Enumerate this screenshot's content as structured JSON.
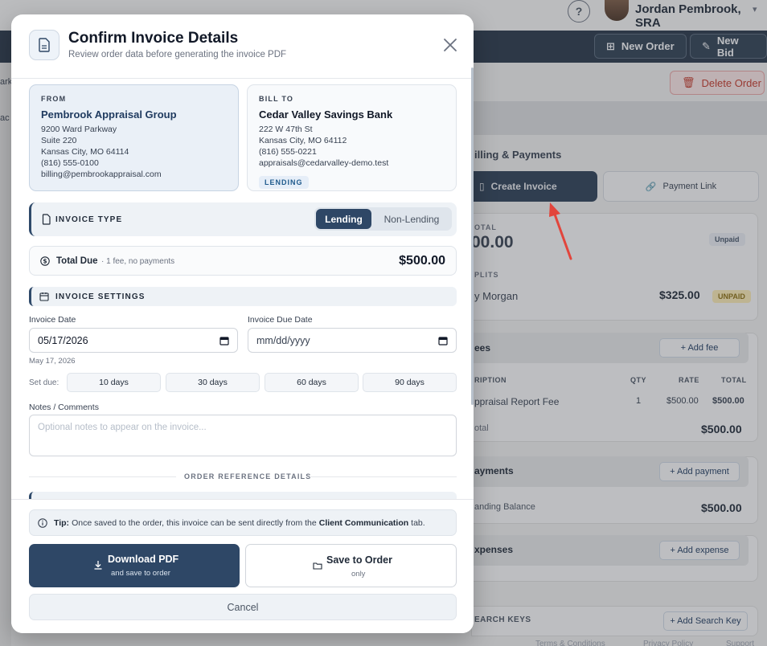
{
  "background": {
    "user_name": "Jordan Pembrook, SRA",
    "nav": {
      "new_order": "New Order",
      "new_bid": "New Bid"
    },
    "delete_order": "Delete Order",
    "billing_title": "illing & Payments",
    "create_invoice": "Create Invoice",
    "payment_link": "Payment Link",
    "total_label": "OTAL",
    "total_value": "00.00",
    "total_status": "Unpaid",
    "splits_label": "PLITS",
    "split_name": "y Morgan",
    "split_amount": "$325.00",
    "split_status": "UNPAID",
    "fees_title": "ees",
    "add_fee": "+ Add fee",
    "table_headers": {
      "desc": "RIPTION",
      "qty": "QTY",
      "rate": "RATE",
      "total": "TOTAL"
    },
    "fee_row": {
      "desc": "ppraisal Report Fee",
      "qty": "1",
      "rate": "$500.00",
      "total": "$500.00"
    },
    "subtotal_label": "otal",
    "subtotal_value": "$500.00",
    "payments_title": "ayments",
    "add_payment": "+ Add payment",
    "outstanding_label": "anding Balance",
    "outstanding_value": "$500.00",
    "expenses_title": "xpenses",
    "add_expense": "+ Add expense",
    "search_keys_title": "EARCH KEYS",
    "add_search_key": "+ Add Search Key",
    "footer_links": [
      "Terms & Conditions",
      "Privacy Policy",
      "Support"
    ],
    "left_peek_1": "ark",
    "left_peek_2": "ac"
  },
  "modal": {
    "title": "Confirm Invoice Details",
    "subtitle": "Review order data before generating the invoice PDF",
    "from": {
      "label": "FROM",
      "name": "Pembrook Appraisal Group",
      "address1": "9200 Ward Parkway",
      "address2": "Suite 220",
      "city": "Kansas City, MO 64114",
      "phone": "(816) 555-0100",
      "email": "billing@pembrookappraisal.com"
    },
    "bill_to": {
      "label": "BILL TO",
      "name": "Cedar Valley Savings Bank",
      "address1": "222 W 47th St",
      "city": "Kansas City, MO 64112",
      "phone": "(816) 555-0221",
      "email": "appraisals@cedarvalley-demo.test",
      "tag": "LENDING"
    },
    "invoice_type": {
      "label": "INVOICE TYPE",
      "options": [
        "Lending",
        "Non-Lending"
      ],
      "selected": "Lending"
    },
    "total_due": {
      "label": "Total Due",
      "sub": "· 1 fee, no payments",
      "amount": "$500.00"
    },
    "invoice_settings": {
      "label": "INVOICE SETTINGS",
      "invoice_date_label": "Invoice Date",
      "invoice_date_value": "05/17/2026",
      "invoice_date_hint": "May 17, 2026",
      "due_date_label": "Invoice Due Date",
      "due_date_value": "mm/dd/yyyy",
      "set_due_label": "Set due:",
      "due_options": [
        "10 days",
        "30 days",
        "60 days",
        "90 days"
      ],
      "notes_label": "Notes / Comments",
      "notes_placeholder": "Optional notes to appear on the invoice..."
    },
    "order_reference_label": "ORDER REFERENCE DETAILS",
    "tip": {
      "prefix": "Tip:",
      "text_before": "Once saved to the order, this invoice can be sent directly from the",
      "emphasis": "Client Communication",
      "text_after": "tab."
    },
    "download": {
      "label": "Download PDF",
      "sub": "and save to order"
    },
    "save": {
      "label": "Save to Order",
      "sub": "only"
    },
    "cancel": "Cancel"
  },
  "colors": {
    "primary": "#2e4766",
    "accent_arrow": "#e2453c",
    "danger": "#c0392b"
  }
}
